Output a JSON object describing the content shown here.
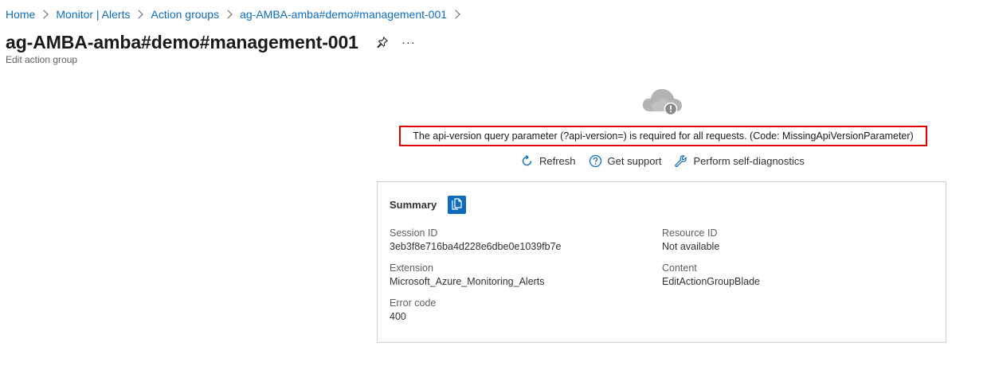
{
  "breadcrumb": {
    "items": [
      {
        "label": "Home"
      },
      {
        "label": "Monitor | Alerts"
      },
      {
        "label": "Action groups"
      },
      {
        "label": "ag-AMBA-amba#demo#management-001"
      }
    ]
  },
  "header": {
    "title": "ag-AMBA-amba#demo#management-001",
    "subtitle": "Edit action group",
    "pin_icon": "pin-icon",
    "more_label": "···"
  },
  "error": {
    "icon": "cloud-error-icon",
    "message": "The api-version query parameter (?api-version=) is required for all requests. (Code: MissingApiVersionParameter)",
    "highlight_color": "#e00000"
  },
  "actions": [
    {
      "label": "Refresh",
      "icon": "refresh-icon"
    },
    {
      "label": "Get support",
      "icon": "help-icon"
    },
    {
      "label": "Perform self-diagnostics",
      "icon": "wrench-icon"
    }
  ],
  "summary": {
    "title": "Summary",
    "copy_icon": "copy-icon",
    "fields": {
      "session_id": {
        "label": "Session ID",
        "value": "3eb3f8e716ba4d228e6dbe0e1039fb7e"
      },
      "resource_id": {
        "label": "Resource ID",
        "value": "Not available"
      },
      "extension": {
        "label": "Extension",
        "value": "Microsoft_Azure_Monitoring_Alerts"
      },
      "content": {
        "label": "Content",
        "value": "EditActionGroupBlade"
      },
      "error_code": {
        "label": "Error code",
        "value": "400"
      }
    }
  },
  "colors": {
    "link": "#0f6cbd",
    "accent": "#0f6cbd",
    "border": "#d2d0ce"
  }
}
